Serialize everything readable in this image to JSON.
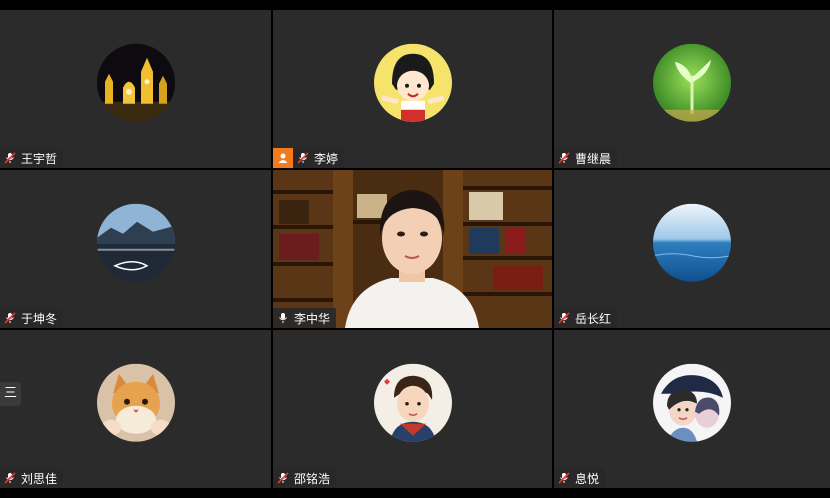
{
  "participants": [
    {
      "name": "王宇哲",
      "avatar": "night-palace-icon"
    },
    {
      "name": "李婷",
      "avatar": "cartoon-girl-icon",
      "host": true
    },
    {
      "name": "曹继晨",
      "avatar": "sprout-icon"
    },
    {
      "name": "于坤冬",
      "avatar": "lake-mountain-icon"
    },
    {
      "name": "李中华",
      "avatar": "video-feed",
      "speaking": true
    },
    {
      "name": "岳长红",
      "avatar": "ocean-sky-icon"
    },
    {
      "name": "刘思佳",
      "avatar": "cat-icon"
    },
    {
      "name": "邵铭浩",
      "avatar": "cartoon-boy-icon"
    },
    {
      "name": "息悦",
      "avatar": "illustrated-woman-icon"
    }
  ],
  "side_label": "三",
  "colors": {
    "tile_bg": "#2b2b2b",
    "host_badge": "#f37b1d",
    "muted_mic": "#e53935"
  }
}
